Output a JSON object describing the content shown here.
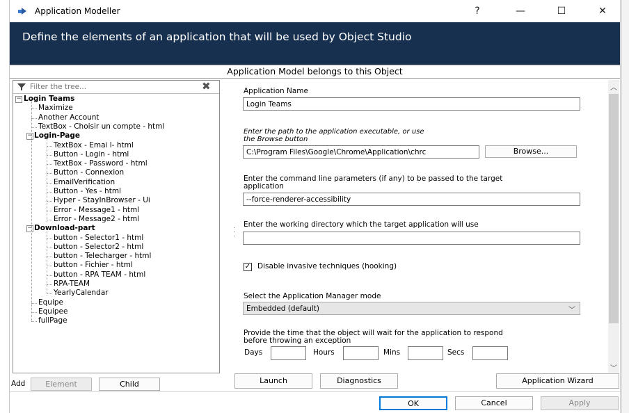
{
  "window": {
    "title": "Application Modeller",
    "help_label": "?",
    "minimize_label": "—",
    "maximize_label": "☐",
    "close_label": "✕"
  },
  "header": {
    "text": "Define the elements of an application that will be used by Object Studio",
    "background": "#17304f"
  },
  "subtitle": "Application Model belongs to this Object",
  "tree": {
    "filter_placeholder": "Filter the tree...",
    "clear_label": "✖",
    "nodes": [
      {
        "label": "Login Teams",
        "bold": true,
        "expander": "⊟"
      },
      {
        "label": "Maximize"
      },
      {
        "label": "Another Account"
      },
      {
        "label": "TextBox - Choisir un compte - html"
      },
      {
        "label": "Login-Page",
        "bold": true,
        "expander": "⊟"
      },
      {
        "label": "TextBox - Emai l- html"
      },
      {
        "label": "Button -  Login - html"
      },
      {
        "label": "TextBox - Password - html"
      },
      {
        "label": "Button - Connexion"
      },
      {
        "label": "EmailVerification"
      },
      {
        "label": "Button - Yes - html"
      },
      {
        "label": "Hyper - StayInBrowser - Ui"
      },
      {
        "label": "Error - Message1 - html"
      },
      {
        "label": "Error - Message2 - html"
      },
      {
        "label": "Download-part",
        "bold": true,
        "expander": "⊟"
      },
      {
        "label": "button -  Selector1 - html"
      },
      {
        "label": "button - Selector2 - html"
      },
      {
        "label": "button -  Telecharger - html"
      },
      {
        "label": "button - Fichier - html"
      },
      {
        "label": "button - RPA TEAM - html"
      },
      {
        "label": "RPA-TEAM"
      },
      {
        "label": "YearlyCalendar"
      },
      {
        "label": "Equipe"
      },
      {
        "label": "Equipee"
      },
      {
        "label": "fullPage"
      }
    ],
    "add_label": "Add",
    "element_button": "Element",
    "child_button": "Child"
  },
  "form": {
    "app_name_label": "Application Name",
    "app_name_value": "Login Teams",
    "path_label_1": "Enter the path to the application executable, or use",
    "path_label_2": "the Browse button",
    "path_value": "C:\\Program Files\\Google\\Chrome\\Application\\chrc",
    "browse_button": "Browse...",
    "cmd_label_1": "Enter the command line parameters (if any) to be passed to the target",
    "cmd_label_2": "application",
    "cmd_value": "--force-renderer-accessibility",
    "workdir_label": "Enter the working directory which the target application will use",
    "workdir_value": "",
    "disable_label": "Disable invasive techniques (hooking)",
    "disable_checked": "✓",
    "mode_label": "Select the Application Manager mode",
    "mode_value": "Embedded (default)",
    "timeout_label_1": "Provide the time that the object will wait for the application to respond",
    "timeout_label_2": "before throwing an exception",
    "days_label": "Days",
    "hours_label": "Hours",
    "mins_label": "Mins",
    "secs_label": "Secs",
    "days_value": "",
    "hours_value": "",
    "mins_value": "",
    "secs_value": ""
  },
  "actions": {
    "launch": "Launch",
    "diagnostics": "Diagnostics",
    "wizard": "Application Wizard"
  },
  "footer": {
    "ok": "OK",
    "cancel": "Cancel",
    "apply": "Apply"
  },
  "colors": {
    "accent": "#0078d7",
    "header": "#17304f"
  }
}
